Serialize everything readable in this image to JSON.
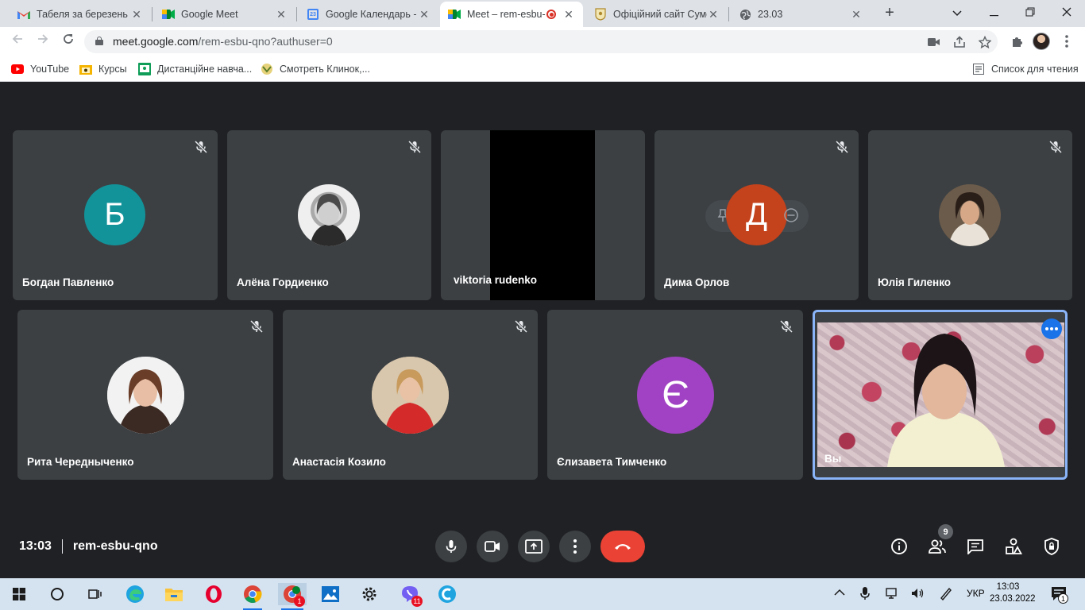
{
  "browser": {
    "tabs": [
      {
        "title": "Табеля за березень в",
        "icon": "gmail-icon",
        "active": false
      },
      {
        "title": "Google Meet",
        "icon": "meet-icon",
        "active": false
      },
      {
        "title": "Google Календарь - с",
        "icon": "calendar-icon",
        "active": false
      },
      {
        "title": "Meet – rem-esbu-",
        "icon": "meet-icon",
        "active": true,
        "recording": true
      },
      {
        "title": "Офіційний сайт Сумс",
        "icon": "crest-icon",
        "active": false
      },
      {
        "title": "23.03",
        "icon": "globe-icon",
        "active": false
      }
    ],
    "calendar_icon_text": "23",
    "new_tab": "+",
    "address": {
      "host": "meet.google.com",
      "path": "/rem-esbu-qno?authuser=0"
    },
    "bookmarks": [
      {
        "label": "YouTube",
        "icon": "youtube-icon"
      },
      {
        "label": "Курсы",
        "icon": "folder-icon"
      },
      {
        "label": "Дистанційне навча...",
        "icon": "classroom-icon"
      },
      {
        "label": "Смотреть Клинок,...",
        "icon": "anime-icon"
      }
    ],
    "reading_list": "Список для чтения"
  },
  "meet": {
    "participants": [
      {
        "name": "Богдан Павленко",
        "avatar": "letter",
        "letter": "Б",
        "color": "#12939a",
        "muted": true
      },
      {
        "name": "Алёна Гордиенко",
        "avatar": "photo",
        "muted": true
      },
      {
        "name": "viktoria rudenko",
        "avatar": "video",
        "muted": false
      },
      {
        "name": "Дима Орлов",
        "avatar": "letter",
        "letter": "Д",
        "color": "#c4421c",
        "muted": true
      },
      {
        "name": "Юлія Гиленко",
        "avatar": "photo",
        "muted": true
      },
      {
        "name": "Рита Чередныченко",
        "avatar": "photo",
        "muted": true
      },
      {
        "name": "Анастасія Козило",
        "avatar": "photo",
        "muted": true
      },
      {
        "name": "Єлизавета Тимченко",
        "avatar": "letter",
        "letter": "Є",
        "color": "#a142c4",
        "muted": true
      }
    ],
    "self": {
      "name": "Вы"
    },
    "time": "13:03",
    "meeting_code": "rem-esbu-qno",
    "people_count": "9",
    "colors": {
      "end_call": "#ea4335",
      "self_border": "#8ab4f8",
      "tile_bg": "#3c4043",
      "stage_bg": "#202124"
    }
  },
  "taskbar": {
    "apps": [
      {
        "name": "start-icon"
      },
      {
        "name": "search-icon"
      },
      {
        "name": "task-view-icon"
      },
      {
        "name": "edge-icon"
      },
      {
        "name": "file-explorer-icon"
      },
      {
        "name": "opera-icon"
      },
      {
        "name": "chrome-icon"
      },
      {
        "name": "chrome-meet-icon",
        "badge": "1"
      },
      {
        "name": "photos-icon"
      },
      {
        "name": "settings-icon"
      },
      {
        "name": "viber-icon",
        "badge": "11"
      },
      {
        "name": "ccleaner-icon"
      }
    ],
    "language": "УКР",
    "clock_time": "13:03",
    "clock_date": "23.03.2022",
    "notification_count": "1"
  }
}
